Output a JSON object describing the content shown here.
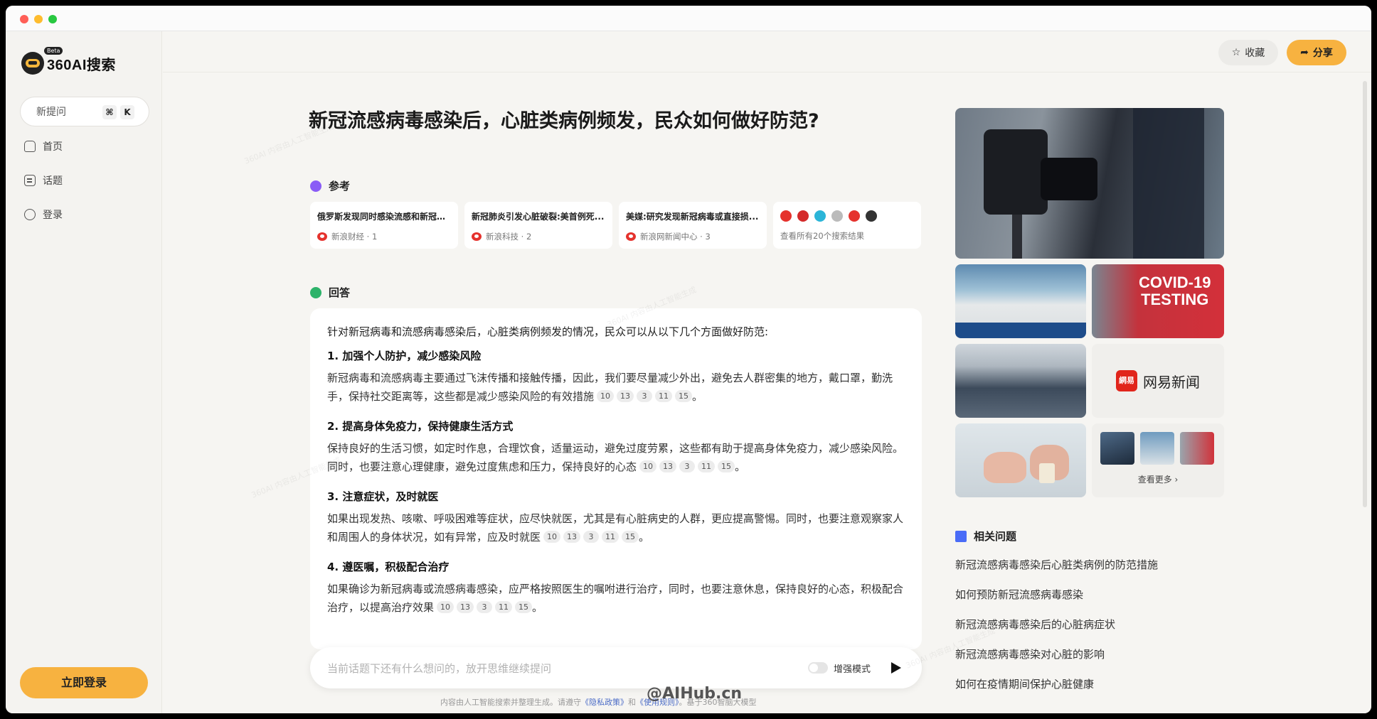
{
  "app": {
    "logo_text": "360AI搜索",
    "beta": "Beta"
  },
  "sidebar": {
    "new_question_label": "新提问",
    "shortcut_keys": [
      "⌘",
      "K"
    ],
    "items": [
      {
        "label": "首页",
        "icon": "home-icon"
      },
      {
        "label": "话题",
        "icon": "topic-icon"
      },
      {
        "label": "登录",
        "icon": "login-icon"
      }
    ],
    "login_button": "立即登录"
  },
  "header": {
    "favorite_label": "收藏",
    "share_label": "分享"
  },
  "page": {
    "title": "新冠流感病毒感染后，心脏类病例频发，民众如何做好防范?"
  },
  "references": {
    "heading": "参考",
    "cards": [
      {
        "title": "俄罗斯发现同时感染流感和新冠病...",
        "source": "新浪财经 · 1"
      },
      {
        "title": "新冠肺炎引发心脏破裂:美首例死...",
        "source": "新浪科技 · 2"
      },
      {
        "title": "美媒:研究发现新冠病毒或直接损...",
        "source": "新浪网新闻中心 · 3"
      }
    ],
    "more_label": "查看所有20个搜索结果"
  },
  "answer": {
    "heading": "回答",
    "intro": "针对新冠病毒和流感病毒感染后，心脏类病例频发的情况，民众可以从以下几个方面做好防范:",
    "sections": [
      {
        "title": "1. 加强个人防护，减少感染风险",
        "text": "新冠病毒和流感病毒主要通过飞沫传播和接触传播，因此，我们要尽量减少外出，避免去人群密集的地方，戴口罩，勤洗手，保持社交距离等，这些都是减少感染风险的有效措施",
        "cites": [
          "10",
          "13",
          "3",
          "11",
          "15"
        ]
      },
      {
        "title": "2. 提高身体免疫力，保持健康生活方式",
        "text": "保持良好的生活习惯，如定时作息，合理饮食，适量运动，避免过度劳累，这些都有助于提高身体免疫力，减少感染风险。同时，也要注意心理健康，避免过度焦虑和压力，保持良好的心态",
        "cites": [
          "10",
          "13",
          "3",
          "11",
          "15"
        ]
      },
      {
        "title": "3. 注意症状，及时就医",
        "text": "如果出现发热、咳嗽、呼吸困难等症状，应尽快就医，尤其是有心脏病史的人群，更应提高警惕。同时，也要注意观察家人和周围人的身体状况，如有异常，应及时就医",
        "cites": [
          "10",
          "13",
          "3",
          "11",
          "15"
        ]
      },
      {
        "title": "4. 遵医嘱，积极配合治疗",
        "text": "如果确诊为新冠病毒或流感病毒感染，应严格按照医生的嘱咐进行治疗，同时，也要注意休息，保持良好的心态，积极配合治疗，以提高治疗效果",
        "cites": [
          "10",
          "13",
          "3",
          "11",
          "15"
        ]
      }
    ]
  },
  "ask": {
    "placeholder": "当前话题下还有什么想问的，放开思维继续提问",
    "toggle_label": "增强模式"
  },
  "footer": {
    "prefix": "内容由人工智能搜索并整理生成。请遵守",
    "privacy": "《隐私政策》",
    "and": "和",
    "terms": "《使用规则》",
    "suffix": "。基于360智脑大模型",
    "watermark": "@AIHub.cn"
  },
  "media": {
    "covid_text_1": "COVID-19",
    "covid_text_2": "TESTING",
    "netease_logo": "網易",
    "netease_name": "网易新闻",
    "see_more": "查看更多 ›"
  },
  "related": {
    "heading": "相关问题",
    "items": [
      "新冠流感病毒感染后心脏类病例的防范措施",
      "如何预防新冠流感病毒感染",
      "新冠流感病毒感染后的心脏病症状",
      "新冠流感病毒感染对心脏的影响",
      "如何在疫情期间保护心脏健康"
    ]
  },
  "watermark_text": "360AI 内容由人工智能生成"
}
